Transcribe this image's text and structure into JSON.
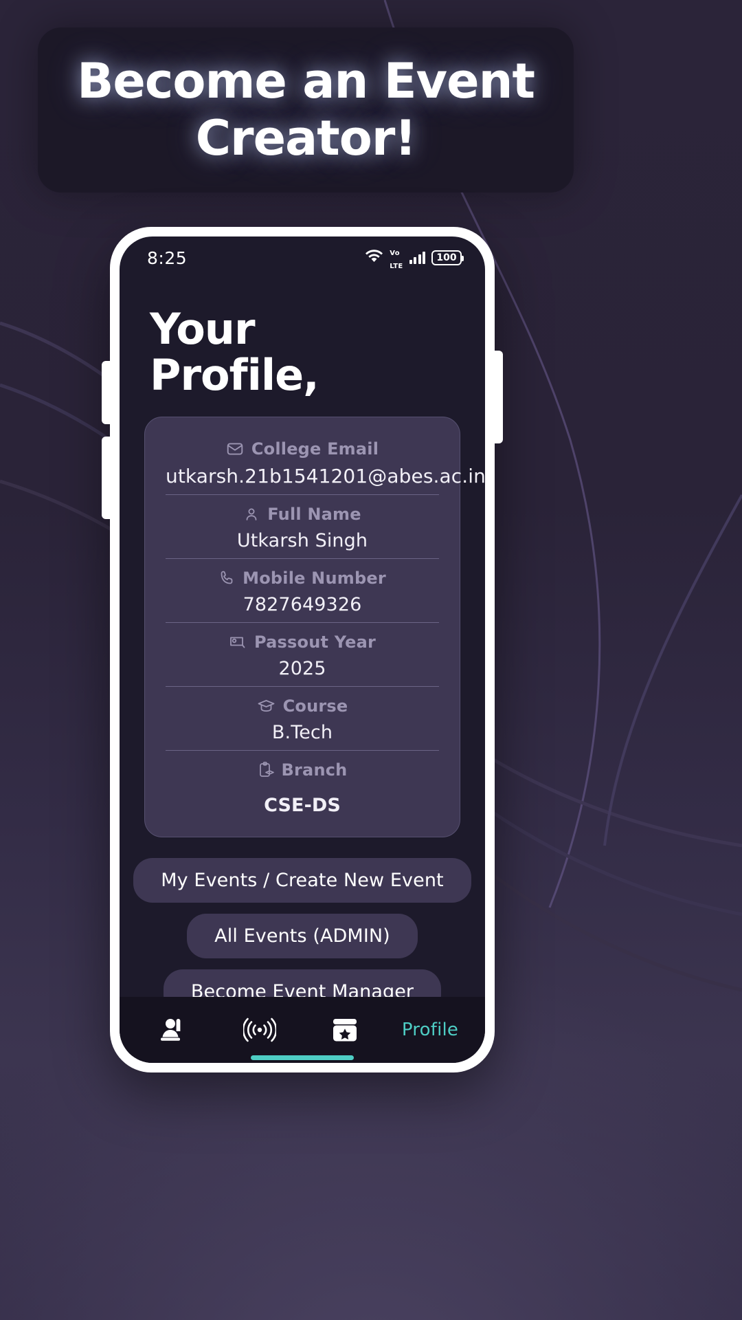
{
  "banner": {
    "line1": "Become an Event",
    "line2": "Creator!"
  },
  "status_bar": {
    "time": "8:25",
    "wifi_icon": "wifi-icon",
    "volte_top": "Vo",
    "volte_bottom": "LTE",
    "signal_icon": "signal-bars-icon",
    "battery_level": "100"
  },
  "page": {
    "title_line1": "Your",
    "title_line2": "Profile,"
  },
  "profile": {
    "fields": [
      {
        "icon": "envelope-icon",
        "label": "College Email",
        "value": "utkarsh.21b1541201@abes.ac.in"
      },
      {
        "icon": "person-icon",
        "label": "Full Name",
        "value": "Utkarsh Singh"
      },
      {
        "icon": "phone-icon",
        "label": "Mobile Number",
        "value": "7827649326"
      },
      {
        "icon": "presentation-icon",
        "label": "Passout Year",
        "value": "2025"
      },
      {
        "icon": "graduation-cap-icon",
        "label": "Course",
        "value": "B.Tech"
      },
      {
        "icon": "clipboard-cap-icon",
        "label": "Branch",
        "value": "CSE-DS"
      }
    ]
  },
  "actions": [
    {
      "label": "My Events / Create New Event"
    },
    {
      "label": "All Events (ADMIN)"
    },
    {
      "label": "Become Event Manager"
    }
  ],
  "bottom_nav": {
    "items": [
      {
        "icon": "raised-hand-person-icon",
        "label": "",
        "active": false
      },
      {
        "icon": "broadcast-icon",
        "label": "",
        "active": false
      },
      {
        "icon": "calendar-star-icon",
        "label": "",
        "active": false
      },
      {
        "icon": "",
        "label": "Profile",
        "active": true
      }
    ]
  },
  "colors": {
    "accent": "#4ecdc4",
    "background": "#2a2438",
    "screen_bg": "#1d1a2b",
    "card_bg": "#3e3753",
    "nav_bg": "#15121f",
    "muted_text": "#9c95b2"
  }
}
